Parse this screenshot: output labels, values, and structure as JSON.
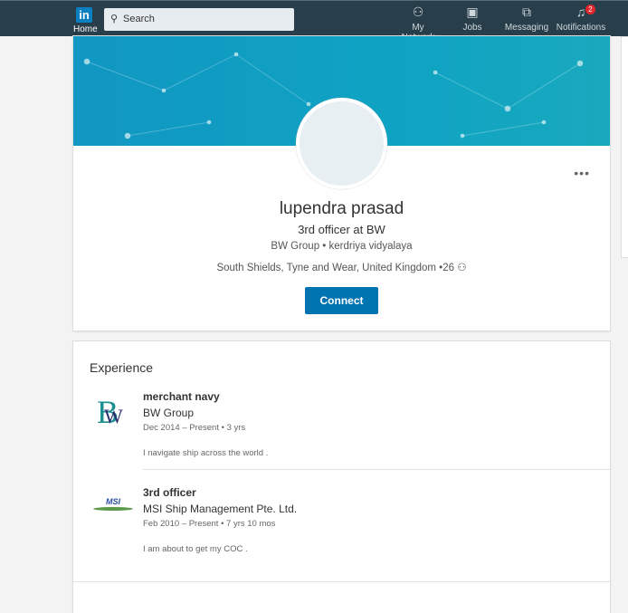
{
  "nav": {
    "logo": "in",
    "home": "Home",
    "search_placeholder": "Search",
    "items": [
      {
        "label": "My Network",
        "icon": "people-icon",
        "glyph": "⚇"
      },
      {
        "label": "Jobs",
        "icon": "briefcase-icon",
        "glyph": "▣"
      },
      {
        "label": "Messaging",
        "icon": "messaging-icon",
        "glyph": "⧉"
      },
      {
        "label": "Notifications",
        "icon": "bell-icon",
        "glyph": "♫",
        "badge": "2"
      }
    ]
  },
  "profile": {
    "name": "lupendra prasad",
    "headline": "3rd officer at BW",
    "education": "BW Group • kerdriya vidyalaya",
    "location": "South Shields, Tyne and Wear, United Kingdom •26",
    "connect": "Connect",
    "more": "•••"
  },
  "experience": {
    "title": "Experience",
    "items": [
      {
        "title": "merchant navy",
        "company": "BW Group",
        "dates": "Dec 2014 – Present  • 3 yrs",
        "description": "I navigate ship across the world ."
      },
      {
        "title": "3rd officer",
        "company": "MSI Ship Management Pte. Ltd.",
        "dates": "Feb 2010 – Present  • 7 yrs 10 mos",
        "description": "I am about to get my COC ."
      }
    ]
  }
}
